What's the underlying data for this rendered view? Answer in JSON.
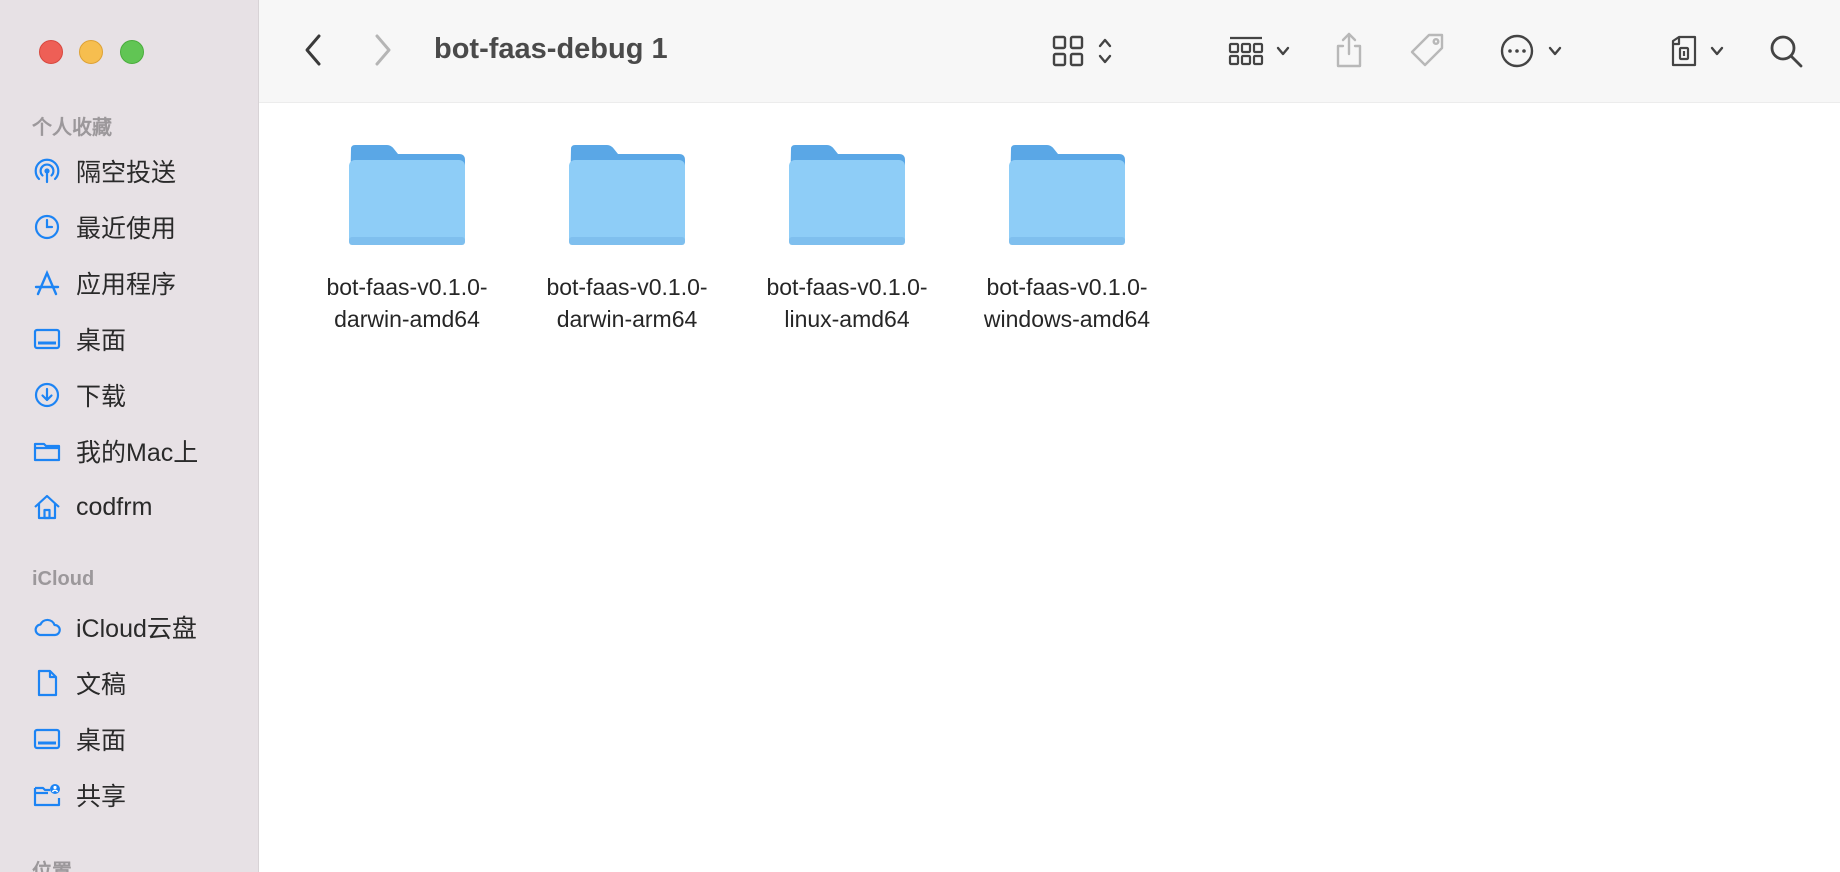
{
  "window": {
    "title": "bot-faas-debug 1"
  },
  "sidebar": {
    "sections": [
      {
        "title": "个人收藏",
        "items": [
          {
            "label": "隔空投送",
            "icon": "airdrop-icon"
          },
          {
            "label": "最近使用",
            "icon": "clock-icon"
          },
          {
            "label": "应用程序",
            "icon": "applications-icon"
          },
          {
            "label": "桌面",
            "icon": "desktop-icon"
          },
          {
            "label": "下载",
            "icon": "download-icon"
          },
          {
            "label": "我的Mac上",
            "icon": "folder-icon"
          },
          {
            "label": "codfrm",
            "icon": "home-icon"
          }
        ]
      },
      {
        "title": "iCloud",
        "items": [
          {
            "label": "iCloud云盘",
            "icon": "icloud-icon"
          },
          {
            "label": "文稿",
            "icon": "document-icon"
          },
          {
            "label": "桌面",
            "icon": "desktop-icon"
          },
          {
            "label": "共享",
            "icon": "shared-folder-icon"
          }
        ]
      },
      {
        "title": "位置",
        "items": []
      }
    ]
  },
  "toolbar": {
    "back_icon": "chevron-left-icon",
    "forward_icon": "chevron-right-icon",
    "view_icon": "grid-view-icon",
    "group_icon": "group-icon",
    "share_icon": "share-icon",
    "tag_icon": "tag-icon",
    "more_icon": "ellipsis-circle-icon",
    "remote_icon": "remote-disk-icon",
    "search_icon": "search-icon"
  },
  "files": [
    {
      "name": "bot-faas-v0.1.0-\ndarwin-amd64",
      "icon": "folder-icon"
    },
    {
      "name": "bot-faas-v0.1.0-\ndarwin-arm64",
      "icon": "folder-icon"
    },
    {
      "name": "bot-faas-v0.1.0-\nlinux-amd64",
      "icon": "folder-icon"
    },
    {
      "name": "bot-faas-v0.1.0-\nwindows-amd64",
      "icon": "folder-icon"
    }
  ],
  "colors": {
    "accent": "#1d84f4",
    "folder_light": "#8ecdf7",
    "folder_dark": "#5aa7e6",
    "sidebar_bg": "#e7e1e5"
  }
}
